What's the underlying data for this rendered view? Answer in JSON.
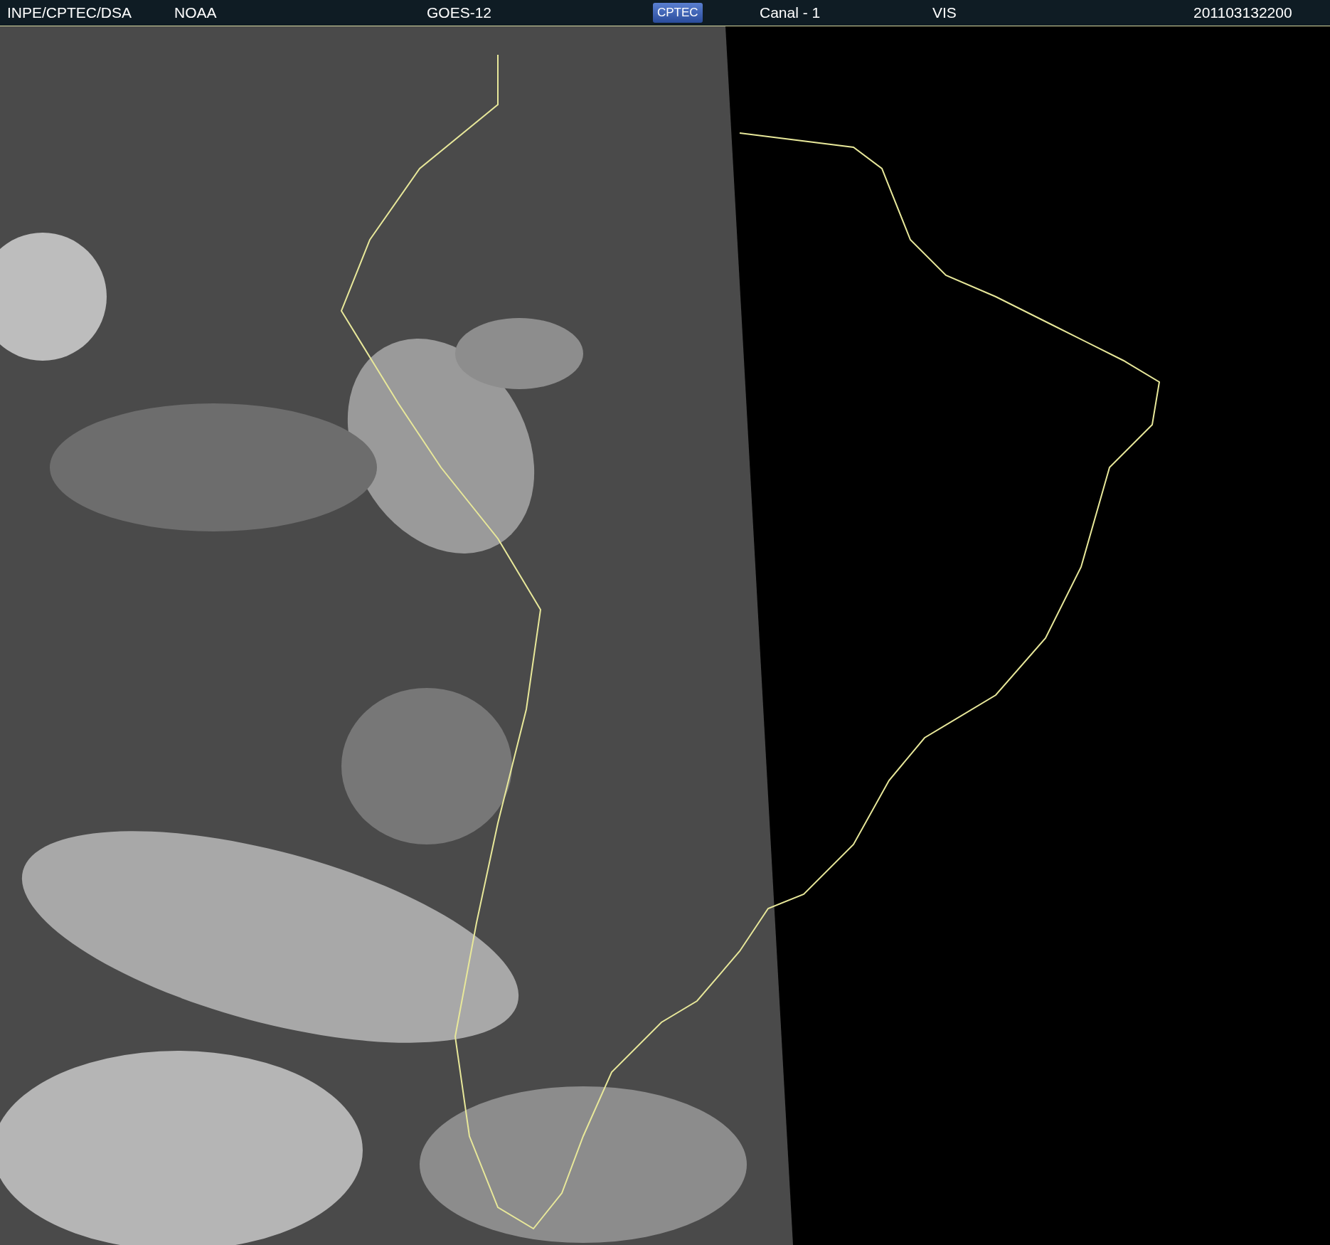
{
  "header": {
    "items": [
      {
        "kind": "text",
        "text": "INPE/CPTEC/DSA"
      },
      {
        "kind": "text",
        "text": "NOAA"
      },
      {
        "kind": "text",
        "text": "GOES-12"
      },
      {
        "kind": "logo",
        "text": "CPTEC"
      },
      {
        "kind": "text",
        "text": "Canal - 1"
      },
      {
        "kind": "text",
        "text": "VIS"
      },
      {
        "kind": "text",
        "text": "201103132200"
      }
    ]
  }
}
